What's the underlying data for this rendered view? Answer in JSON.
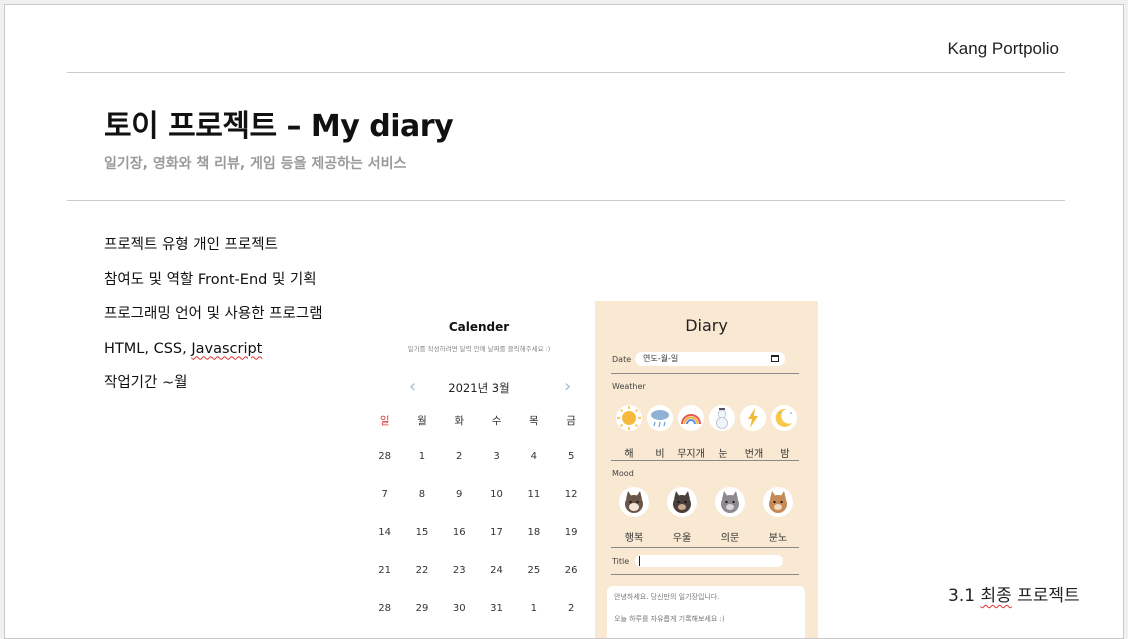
{
  "header": {
    "brand": "Kang Portpolio"
  },
  "title": "토이 프로젝트 – My diary",
  "subtitle": "일기장, 영화와 책 리뷰, 게임 등을 제공하는 서비스",
  "info": [
    {
      "label": "프로젝트 유형",
      "value": "개인 프로젝트"
    },
    {
      "label": "참여도 및 역할",
      "value": "Front-End 및 기획"
    },
    {
      "label": "프로그래밍 언어 및 사용한 프로그램",
      "value": ""
    },
    {
      "label": "",
      "value": "HTML, CSS, ",
      "value2": "Javascript"
    },
    {
      "label": "작업기간",
      "value": "~월"
    }
  ],
  "footer": {
    "prefix": "3.1 ",
    "word": "최종",
    "suffix": " 프로젝트"
  },
  "calendar": {
    "title": "Calender",
    "subtitle": "일기를 작성하려면 달력 안에 날짜를 클릭해주세요 :)",
    "month": "2021년 3월",
    "prev_icon": "chevron-left-icon",
    "next_icon": "chevron-right-icon",
    "weekdays": [
      "일",
      "월",
      "화",
      "수",
      "목",
      "금"
    ],
    "weeks": [
      [
        "28",
        "1",
        "2",
        "3",
        "4",
        "5"
      ],
      [
        "7",
        "8",
        "9",
        "10",
        "11",
        "12"
      ],
      [
        "14",
        "15",
        "16",
        "17",
        "18",
        "19"
      ],
      [
        "21",
        "22",
        "23",
        "24",
        "25",
        "26"
      ],
      [
        "28",
        "29",
        "30",
        "31",
        "1",
        "2"
      ]
    ],
    "sunday_color": "#dd3333"
  },
  "diary": {
    "title": "Diary",
    "date_label": "Date",
    "date_placeholder": "연도-월-일",
    "weather_label": "Weather",
    "weather": [
      {
        "label": "해",
        "icon": "sun-icon"
      },
      {
        "label": "비",
        "icon": "rain-cloud-icon"
      },
      {
        "label": "무지개",
        "icon": "rainbow-icon"
      },
      {
        "label": "눈",
        "icon": "snowman-icon"
      },
      {
        "label": "번개",
        "icon": "lightning-icon"
      },
      {
        "label": "밤",
        "icon": "moon-icon"
      }
    ],
    "mood_label": "Mood",
    "moods": [
      {
        "label": "행복",
        "icon": "happy-cat-icon"
      },
      {
        "label": "우울",
        "icon": "sad-cat-icon"
      },
      {
        "label": "의문",
        "icon": "curious-cat-icon"
      },
      {
        "label": "분노",
        "icon": "angry-cat-icon"
      }
    ],
    "title_label": "Title",
    "body_lines": [
      "안녕하세요. 당신만의 일기장입니다.",
      "오늘 하루를 자유롭게 기록해보세요 :)"
    ],
    "bg_color": "#f9e8d2"
  }
}
